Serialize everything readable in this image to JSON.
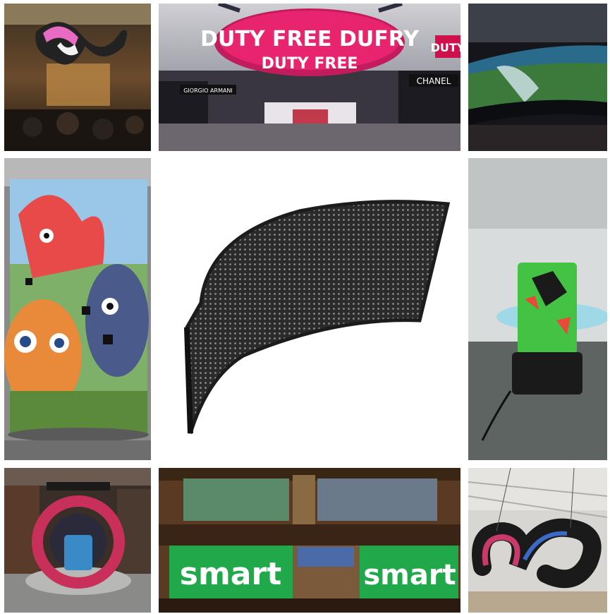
{
  "tiles": {
    "duty_free": {
      "sign_top": "DUTY FREE DUFRY",
      "sign_bottom": "DUTY FREE",
      "sign_right": "DUTY",
      "shop_left": "GIORGIO ARMANI",
      "shop_right": "CHANEL"
    },
    "smart_stand": {
      "left_sign": "smart",
      "right_sign": "smart"
    }
  },
  "colors": {
    "sign_pink": "#e8246e",
    "smart_green": "#21a84b",
    "panel_dark": "#2b2b2b"
  }
}
